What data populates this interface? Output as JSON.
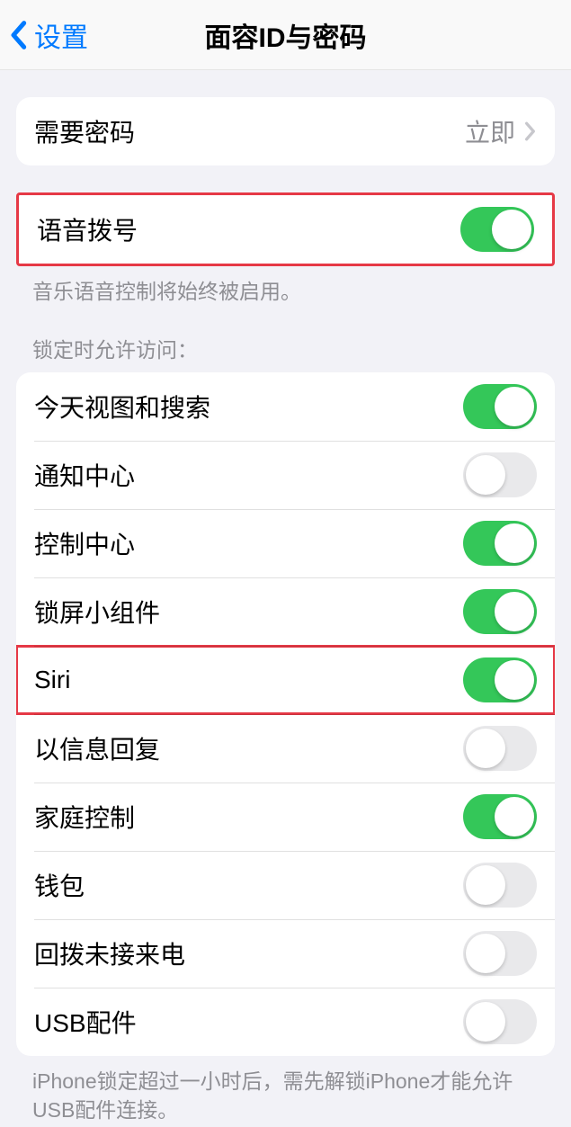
{
  "nav": {
    "back_label": "设置",
    "title": "面容ID与密码"
  },
  "require_passcode": {
    "label": "需要密码",
    "value": "立即"
  },
  "voice_dial": {
    "label": "语音拨号",
    "on": true,
    "footer": "音乐语音控制将始终被启用。"
  },
  "allow_access_header": "锁定时允许访问：",
  "allow_access": [
    {
      "label": "今天视图和搜索",
      "on": true,
      "highlighted": false
    },
    {
      "label": "通知中心",
      "on": false,
      "highlighted": false
    },
    {
      "label": "控制中心",
      "on": true,
      "highlighted": false
    },
    {
      "label": "锁屏小组件",
      "on": true,
      "highlighted": false
    },
    {
      "label": "Siri",
      "on": true,
      "highlighted": true
    },
    {
      "label": "以信息回复",
      "on": false,
      "highlighted": false
    },
    {
      "label": "家庭控制",
      "on": true,
      "highlighted": false
    },
    {
      "label": "钱包",
      "on": false,
      "highlighted": false
    },
    {
      "label": "回拨未接来电",
      "on": false,
      "highlighted": false
    },
    {
      "label": "USB配件",
      "on": false,
      "highlighted": false
    }
  ],
  "usb_footer": "iPhone锁定超过一小时后，需先解锁iPhone才能允许USB配件连接。"
}
